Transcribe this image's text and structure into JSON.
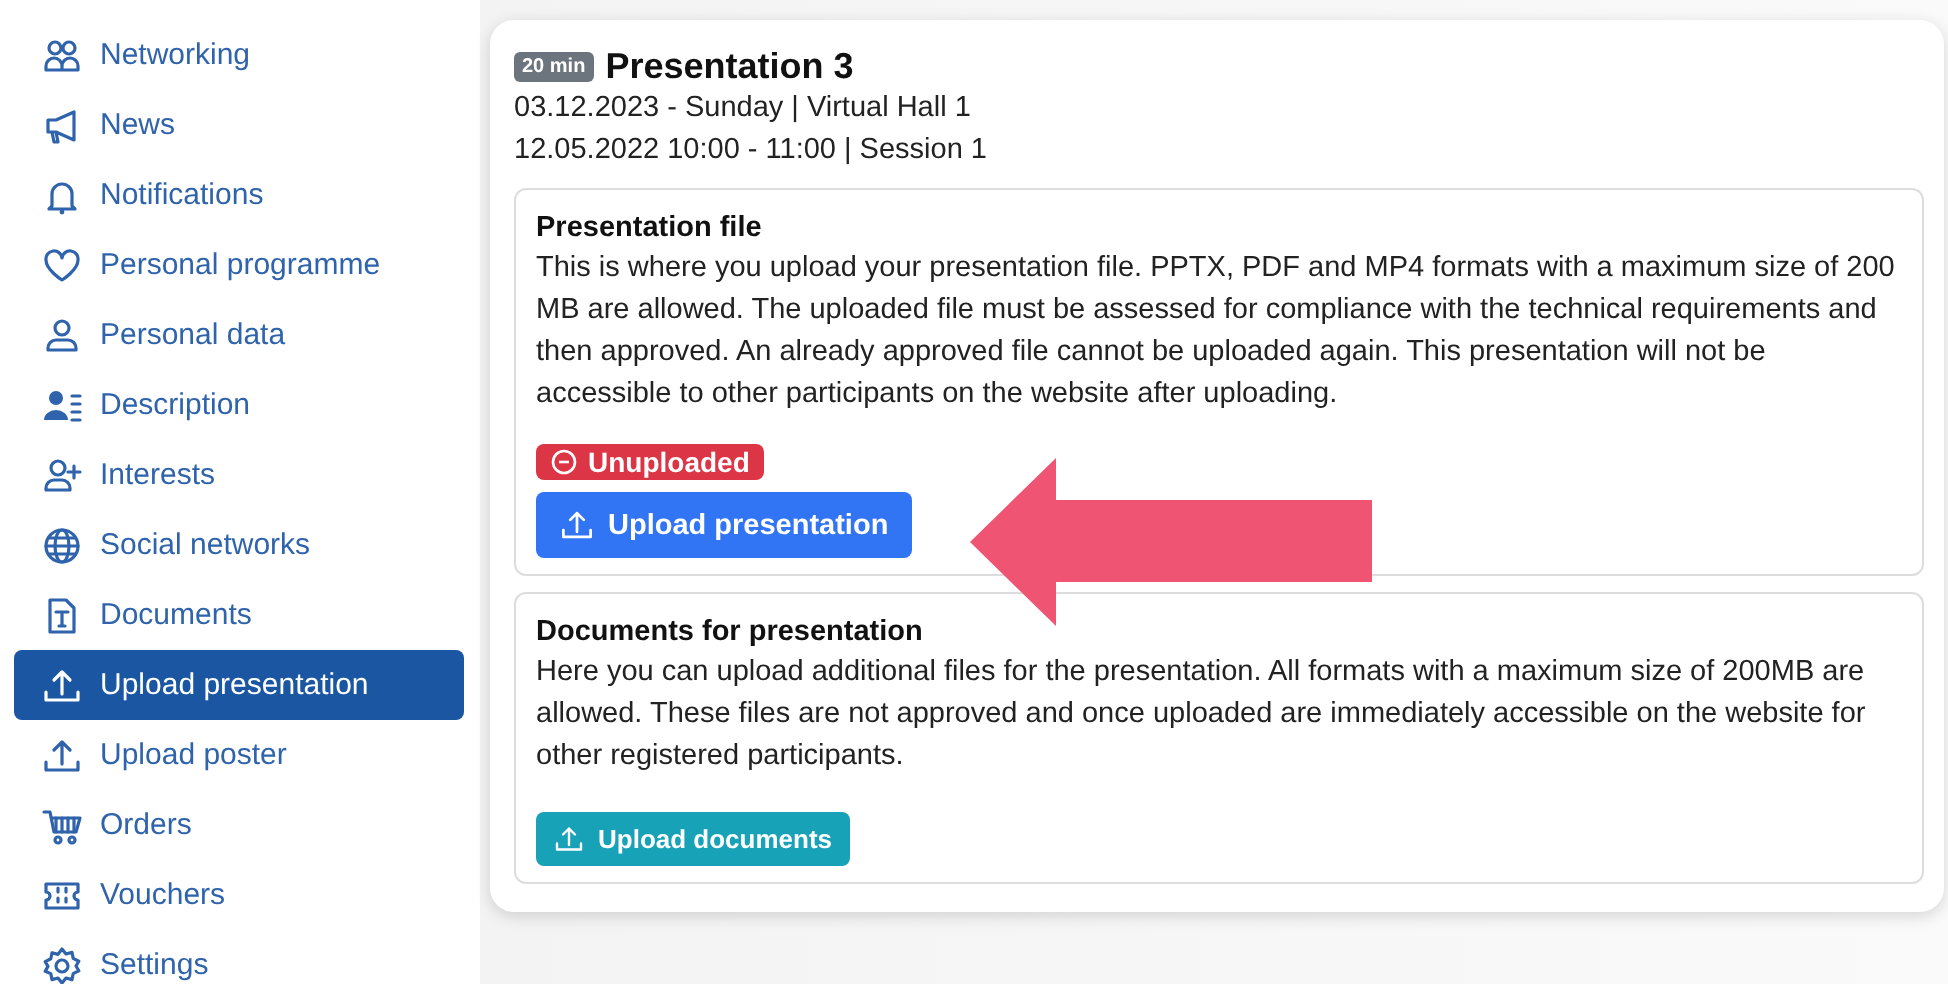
{
  "sidebar": {
    "items": [
      {
        "label": "Networking",
        "selected": false
      },
      {
        "label": "News",
        "selected": false
      },
      {
        "label": "Notifications",
        "selected": false
      },
      {
        "label": "Personal programme",
        "selected": false
      },
      {
        "label": "Personal data",
        "selected": false
      },
      {
        "label": "Description",
        "selected": false
      },
      {
        "label": "Interests",
        "selected": false
      },
      {
        "label": "Social networks",
        "selected": false
      },
      {
        "label": "Documents",
        "selected": false
      },
      {
        "label": "Upload presentation",
        "selected": true
      },
      {
        "label": "Upload poster",
        "selected": false
      },
      {
        "label": "Orders",
        "selected": false
      },
      {
        "label": "Vouchers",
        "selected": false
      },
      {
        "label": "Settings",
        "selected": false
      }
    ]
  },
  "presentation": {
    "duration": "20 min",
    "title": "Presentation 3",
    "date_line": "03.12.2023 - Sunday | Virtual Hall 1",
    "time_line": "12.05.2022 10:00 - 11:00 | Session 1",
    "sections": [
      {
        "heading": "Presentation file",
        "text": "This is where you upload your presentation file. PPTX, PDF and MP4 formats with a maximum size of 200 MB are allowed. The uploaded file must be assessed for compliance with the technical requirements and then approved. An already approved file cannot be uploaded again. This presentation will not be accessible to other participants on the website after uploading.",
        "status": "Unuploaded",
        "button": "Upload presentation",
        "kind": "primary"
      },
      {
        "heading": "Documents for presentation",
        "text": "Here you can upload additional files for the presentation. All formats with a maximum size of 200MB are allowed. These files are not approved and once uploaded are immediately accessible on the website for other registered participants.",
        "button": "Upload documents",
        "kind": "info"
      }
    ]
  }
}
